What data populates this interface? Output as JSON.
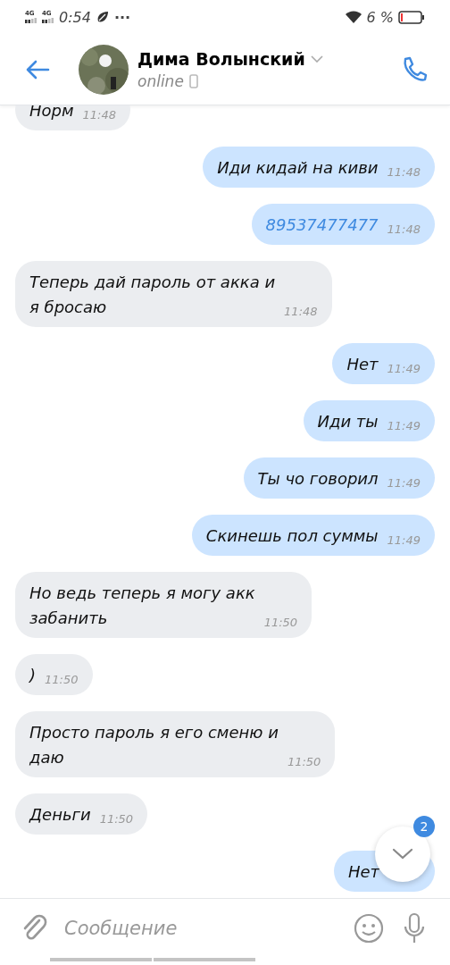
{
  "status_bar": {
    "networks": [
      "4G",
      "4G"
    ],
    "time": "0:54",
    "more": "···",
    "battery_percent": "6 %"
  },
  "header": {
    "name": "Дима Волынский",
    "status": "online"
  },
  "messages": [
    {
      "text": "Норм",
      "time": "11:48",
      "outgoing": false,
      "kind": "text"
    },
    {
      "text": "Иди кидай на киви",
      "time": "11:48",
      "outgoing": true,
      "kind": "text"
    },
    {
      "text": "89537477477",
      "time": "11:48",
      "outgoing": true,
      "kind": "link"
    },
    {
      "text": "Теперь дай пароль от акка  и\nя бросаю",
      "time": "11:48",
      "outgoing": false,
      "kind": "text"
    },
    {
      "text": "Нет",
      "time": "11:49",
      "outgoing": true,
      "kind": "text"
    },
    {
      "text": "Иди ты",
      "time": "11:49",
      "outgoing": true,
      "kind": "text"
    },
    {
      "text": "Ты чо говорил",
      "time": "11:49",
      "outgoing": true,
      "kind": "text"
    },
    {
      "text": "Скинешь пол суммы",
      "time": "11:49",
      "outgoing": true,
      "kind": "text"
    },
    {
      "text": "Но ведь теперь я могу акк\nзабанить",
      "time": "11:50",
      "outgoing": false,
      "kind": "text"
    },
    {
      "text": ")",
      "time": "11:50",
      "outgoing": false,
      "kind": "text"
    },
    {
      "text": "Просто пароль я его сменю и\nдаю",
      "time": "11:50",
      "outgoing": false,
      "kind": "text"
    },
    {
      "text": "Деньги",
      "time": "11:50",
      "outgoing": false,
      "kind": "text"
    },
    {
      "text": "Нет",
      "outgoing": true,
      "kind": "text"
    }
  ],
  "scroll_button": {
    "badge": "2"
  },
  "composer": {
    "placeholder": "Сообщение"
  }
}
